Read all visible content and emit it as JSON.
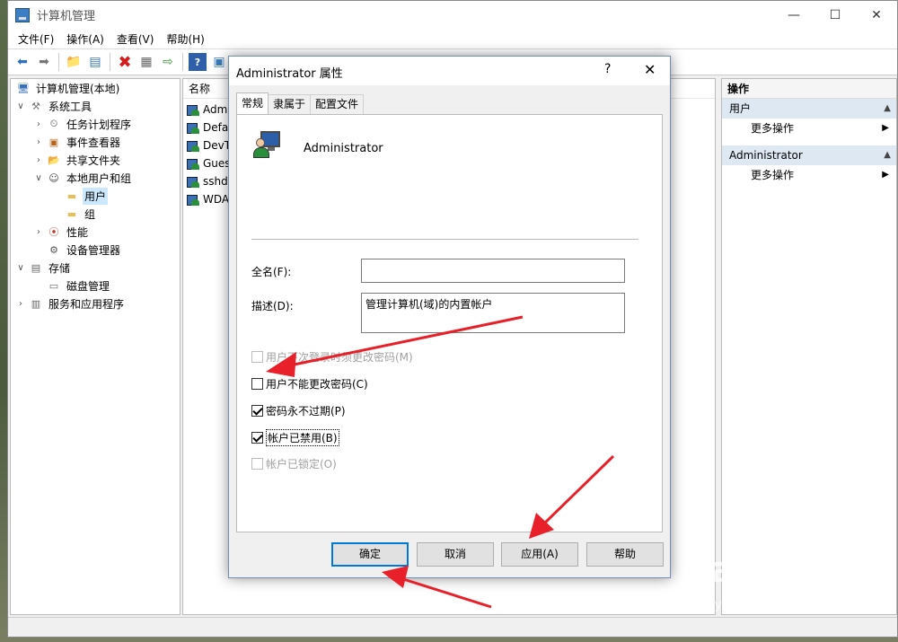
{
  "window": {
    "title": "计算机管理",
    "controls": {
      "minimize": "—",
      "maximize": "☐",
      "close": "✕"
    }
  },
  "menu": [
    "文件(F)",
    "操作(A)",
    "查看(V)",
    "帮助(H)"
  ],
  "toolbar_icons": [
    "back-arrow-icon",
    "forward-arrow-icon",
    "up-folder-icon",
    "show-hide-tree-icon",
    "delete-icon",
    "properties-icon",
    "export-icon",
    "help-icon",
    "show-action-pane-icon"
  ],
  "tree": {
    "root": "计算机管理(本地)",
    "system_tools": "系统工具",
    "task_scheduler": "任务计划程序",
    "event_viewer": "事件查看器",
    "shared_folders": "共享文件夹",
    "local_users_groups": "本地用户和组",
    "users": "用户",
    "groups": "组",
    "performance": "性能",
    "device_manager": "设备管理器",
    "storage": "存储",
    "disk_management": "磁盘管理",
    "services_apps": "服务和应用程序"
  },
  "list": {
    "header": "名称",
    "rows": [
      "Admi",
      "Defa",
      "DevT",
      "Gues",
      "sshd",
      "WDA"
    ]
  },
  "actions": {
    "header": "操作",
    "section1": "用户",
    "more1": "更多操作",
    "section2": "Administrator",
    "more2": "更多操作"
  },
  "dialog": {
    "title": "Administrator 属性",
    "help": "?",
    "close": "✕",
    "tabs": [
      "常规",
      "隶属于",
      "配置文件"
    ],
    "username": "Administrator",
    "fullname_label": "全名(F):",
    "fullname_value": "",
    "desc_label": "描述(D):",
    "desc_value": "管理计算机(域)的内置帐户",
    "cb_must_change": "用户下次登录时须更改密码(M)",
    "cb_cannot_change": "用户不能更改密码(C)",
    "cb_never_expires": "密码永不过期(P)",
    "cb_disabled": "帐户已禁用(B)",
    "cb_locked": "帐户已锁定(O)",
    "btn_ok": "确定",
    "btn_cancel": "取消",
    "btn_apply": "应用(A)",
    "btn_help": "帮助"
  },
  "checkbox_state": {
    "must_change": false,
    "cannot_change": false,
    "never_expires": true,
    "disabled": true,
    "locked": false
  },
  "watermark": {
    "main": "Bai du 经验",
    "sub": "jingyan.baidu.com"
  },
  "colors": {
    "annotation_arrow": "#e8202a",
    "selection": "#cce8ff",
    "default_button_border": "#0078d7"
  }
}
